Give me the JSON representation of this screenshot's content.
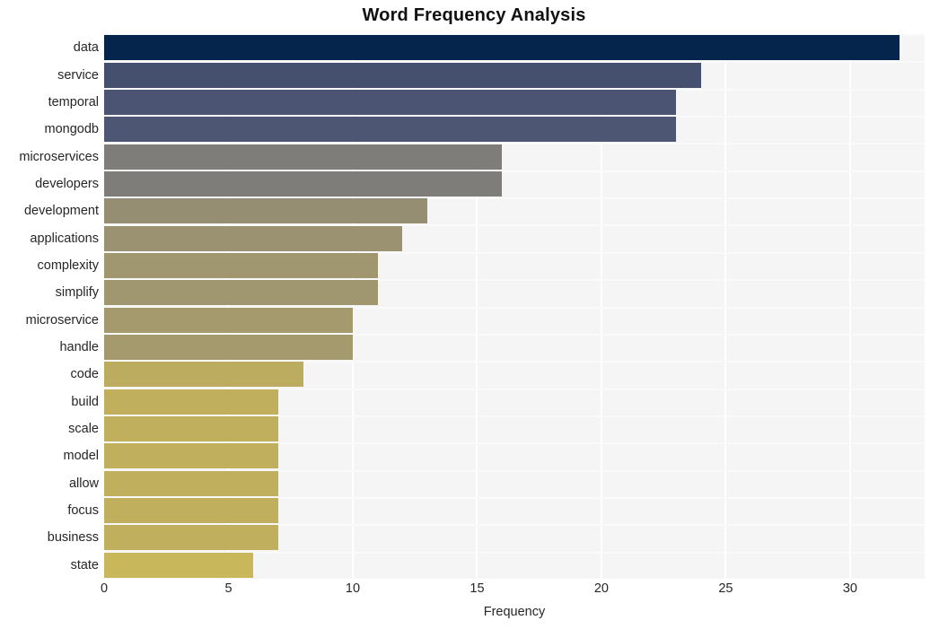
{
  "chart_data": {
    "type": "bar",
    "orientation": "horizontal",
    "title": "Word Frequency Analysis",
    "xlabel": "Frequency",
    "ylabel": "",
    "categories": [
      "data",
      "service",
      "temporal",
      "mongodb",
      "microservices",
      "developers",
      "development",
      "applications",
      "complexity",
      "simplify",
      "microservice",
      "handle",
      "code",
      "build",
      "scale",
      "model",
      "allow",
      "focus",
      "business",
      "state"
    ],
    "values": [
      32,
      24,
      23,
      23,
      16,
      16,
      13,
      12,
      11,
      11,
      10,
      10,
      8,
      7,
      7,
      7,
      7,
      7,
      7,
      6
    ],
    "xlim": [
      0,
      33
    ],
    "xticks": [
      0,
      5,
      10,
      15,
      20,
      25,
      30
    ],
    "xtick_labels": [
      "0",
      "5",
      "10",
      "15",
      "20",
      "25",
      "30"
    ],
    "grid": true,
    "legend": null,
    "bar_colors": [
      "#05254c",
      "#454f6e",
      "#4b5472",
      "#4d5673",
      "#7e7d79",
      "#7e7d79",
      "#958e73",
      "#9a9270",
      "#a09670",
      "#a09670",
      "#a49a6e",
      "#a49a6e",
      "#bcac5f",
      "#c0b05e",
      "#c0b05e",
      "#c0b05e",
      "#c0b05e",
      "#c0b05e",
      "#c0b05e",
      "#c8b75b"
    ],
    "plot_background": "#f5f5f5",
    "gridline_color": "#ffffff",
    "figure_background": "#ffffff"
  }
}
